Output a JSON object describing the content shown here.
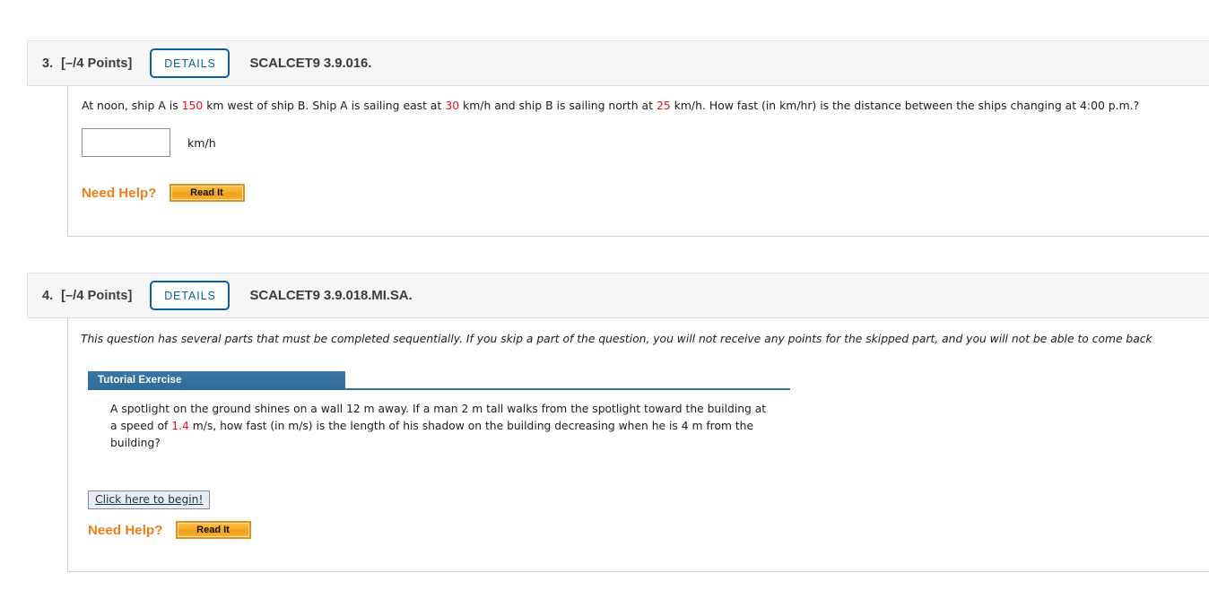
{
  "questions": [
    {
      "number": "3.",
      "points": "[–/4 Points]",
      "details_label": "DETAILS",
      "code": "SCALCET9 3.9.016.",
      "prompt": {
        "seg1": "At noon, ship A is ",
        "val1": "150",
        "seg2": " km west of ship B. Ship A is sailing east at ",
        "val2": "30",
        "seg3": " km/h and ship B is sailing north at ",
        "val3": "25",
        "seg4": " km/h. How fast (in km/hr) is the distance between the ships changing at 4:00 p.m.?"
      },
      "answer_value": "",
      "answer_placeholder": "",
      "unit": "km/h",
      "need_help_label": "Need Help?",
      "read_it_label": "Read It"
    },
    {
      "number": "4.",
      "points": "[–/4 Points]",
      "details_label": "DETAILS",
      "code": "SCALCET9 3.9.018.MI.SA.",
      "multipart_note": "This question has several parts that must be completed sequentially. If you skip a part of the question, you will not receive any points for the skipped part, and you will not be able to come back",
      "tutorial_header": "Tutorial Exercise",
      "tutorial": {
        "seg1": "A spotlight on the ground shines on a wall 12 m away. If a man 2 m tall walks from the spotlight toward the building at a speed of ",
        "val1": "1.4",
        "seg2": " m/s, how fast (in m/s) is the length of his shadow on the building decreasing when he is 4 m from the building?"
      },
      "begin_label": "Click here to begin!",
      "need_help_label": "Need Help?",
      "read_it_label": "Read It"
    }
  ],
  "colors": {
    "accent_blue": "#0a6099",
    "tutorial_blue": "#35729e",
    "orange": "#f07d17",
    "red_value": "#e8101a"
  }
}
